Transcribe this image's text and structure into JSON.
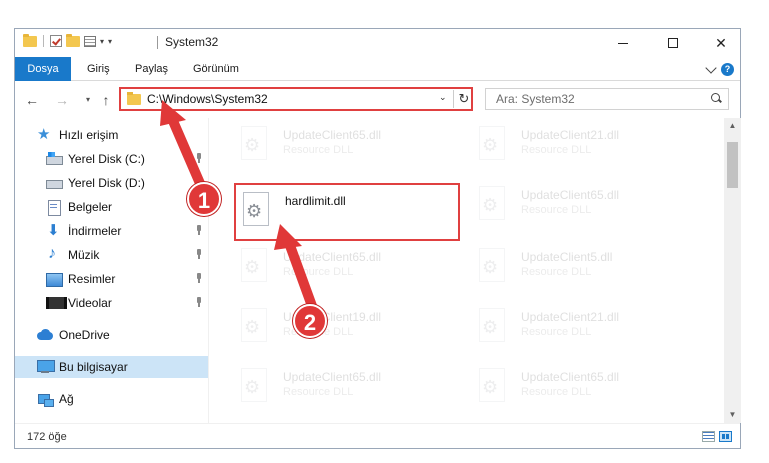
{
  "window": {
    "title": "System32"
  },
  "ribbon": {
    "tabs": [
      "Dosya",
      "Giriş",
      "Paylaş",
      "Görünüm"
    ]
  },
  "address": {
    "path": "C:\\Windows\\System32",
    "search_placeholder": "Ara: System32"
  },
  "nav": {
    "quick_access": "Hızlı erişim",
    "items": [
      "Yerel Disk (C:)",
      "Yerel Disk (D:)",
      "Belgeler",
      "İndirmeler",
      "Müzik",
      "Resimler",
      "Videolar"
    ],
    "onedrive": "OneDrive",
    "this_pc": "Bu bilgisayar",
    "network": "Ağ"
  },
  "files": {
    "left_col": [
      {
        "name": "UpdateClient65.dll",
        "type": "Resource DLL"
      },
      {
        "name": "hardlimit.dll",
        "type": ""
      },
      {
        "name": "UpdateClient65.dll",
        "type": "Resource DLL"
      },
      {
        "name": "UpdateClient19.dll",
        "type": "Resource DLL"
      },
      {
        "name": "UpdateClient65.dll",
        "type": "Resource DLL"
      }
    ],
    "right_col": [
      {
        "name": "UpdateClient21.dll",
        "type": "Resource DLL"
      },
      {
        "name": "UpdateClient65.dll",
        "type": "Resource DLL"
      },
      {
        "name": "UpdateClient5.dll",
        "type": "Resource DLL"
      },
      {
        "name": "UpdateClient21.dll",
        "type": "Resource DLL"
      },
      {
        "name": "UpdateClient65.dll",
        "type": "Resource DLL"
      }
    ]
  },
  "status": {
    "count": "172 öğe"
  },
  "annotations": {
    "step1": "1",
    "step2": "2"
  },
  "colors": {
    "accent": "#1979ca",
    "highlight_red": "#e04040"
  }
}
